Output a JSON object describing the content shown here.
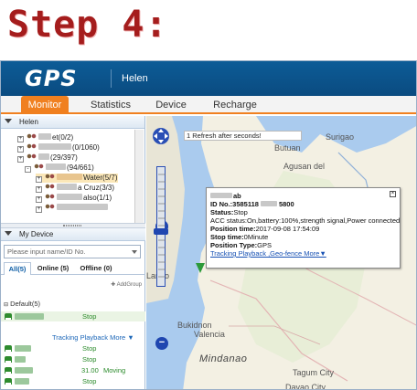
{
  "caption": "Step 4:",
  "header": {
    "logo": "GPS",
    "user": "Helen"
  },
  "nav": {
    "tabs": [
      "Monitor",
      "Statistics",
      "Device",
      "Recharge"
    ],
    "active": 0
  },
  "tree": {
    "title": "Helen",
    "nodes": [
      {
        "text": "et(0/2)",
        "sign": "+"
      },
      {
        "text": "(0/1060)",
        "sign": "+"
      },
      {
        "text": "(29/397)",
        "sign": "+"
      },
      {
        "text": "(94/661)",
        "sign": "-"
      },
      {
        "text": "Water(5/7)",
        "sign": "+"
      },
      {
        "text": "a Cruz(3/3)",
        "sign": "+"
      },
      {
        "text": "also(1/1)",
        "sign": "+"
      }
    ]
  },
  "device_panel": {
    "title": "My Device",
    "search_placeholder": "Please input name/ID No.",
    "tabs": [
      "All(5)",
      "Online (5)",
      "Offline (0)"
    ],
    "add_group": "AddGroup",
    "group": "Default(5)",
    "links": "Tracking Playback More ▼",
    "rows": [
      {
        "status": "Stop",
        "speed": ""
      },
      {
        "status": "Stop",
        "speed": ""
      },
      {
        "status": "Stop",
        "speed": ""
      },
      {
        "status": "Moving",
        "speed": "31.00"
      },
      {
        "status": "Stop",
        "speed": ""
      }
    ]
  },
  "map": {
    "refresh_text": "1 Refresh after seconds!",
    "labels": [
      "Mindanao",
      "Davao City",
      "Tagum City",
      "Agusan del",
      "Surigao",
      "Butuan",
      "Valencia",
      "Bukidnon",
      "Lanao"
    ],
    "popup": {
      "name_suffix": "ab",
      "id_prefix": "ID No.:3585118",
      "id_suffix": "5800",
      "status_label": "Status:",
      "status_value": "Stop",
      "acc": "ACC status:On,battery:100%,strength signal,Power connected",
      "position_time_label": "Position time:",
      "position_time": "2017-09-08 17:54:09",
      "stop_time_label": "Stop time:",
      "stop_time": "0Minute",
      "position_type_label": "Position Type:",
      "position_type": "GPS",
      "links": "Tracking Playback ,Geo-fence More▼"
    }
  }
}
